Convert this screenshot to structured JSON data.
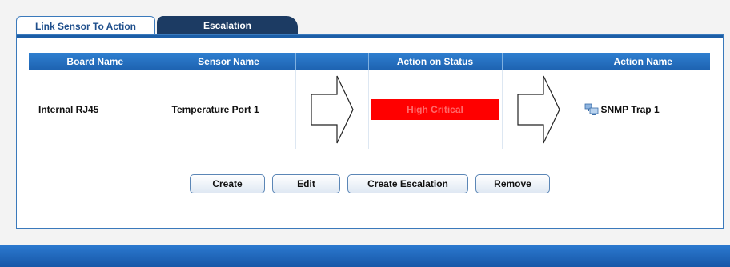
{
  "tabs": [
    {
      "label": "Link Sensor To Action",
      "active": true
    },
    {
      "label": "Escalation",
      "active": false
    }
  ],
  "table": {
    "headers": [
      "Board Name",
      "Sensor Name",
      "",
      "Action on Status",
      "",
      "Action Name"
    ],
    "rows": [
      {
        "board_name": "Internal RJ45",
        "sensor_name": "Temperature Port 1",
        "action_on_status": "High Critical",
        "status_color": "#ff0000",
        "action_name": "SNMP Trap 1",
        "action_icon": "network-computer-icon"
      }
    ]
  },
  "buttons": {
    "create": "Create",
    "edit": "Edit",
    "create_escalation": "Create Escalation",
    "remove": "Remove"
  },
  "colors": {
    "header_blue": "#1d62b0",
    "tab_dark": "#1c3b63",
    "status_red": "#ff0000"
  }
}
